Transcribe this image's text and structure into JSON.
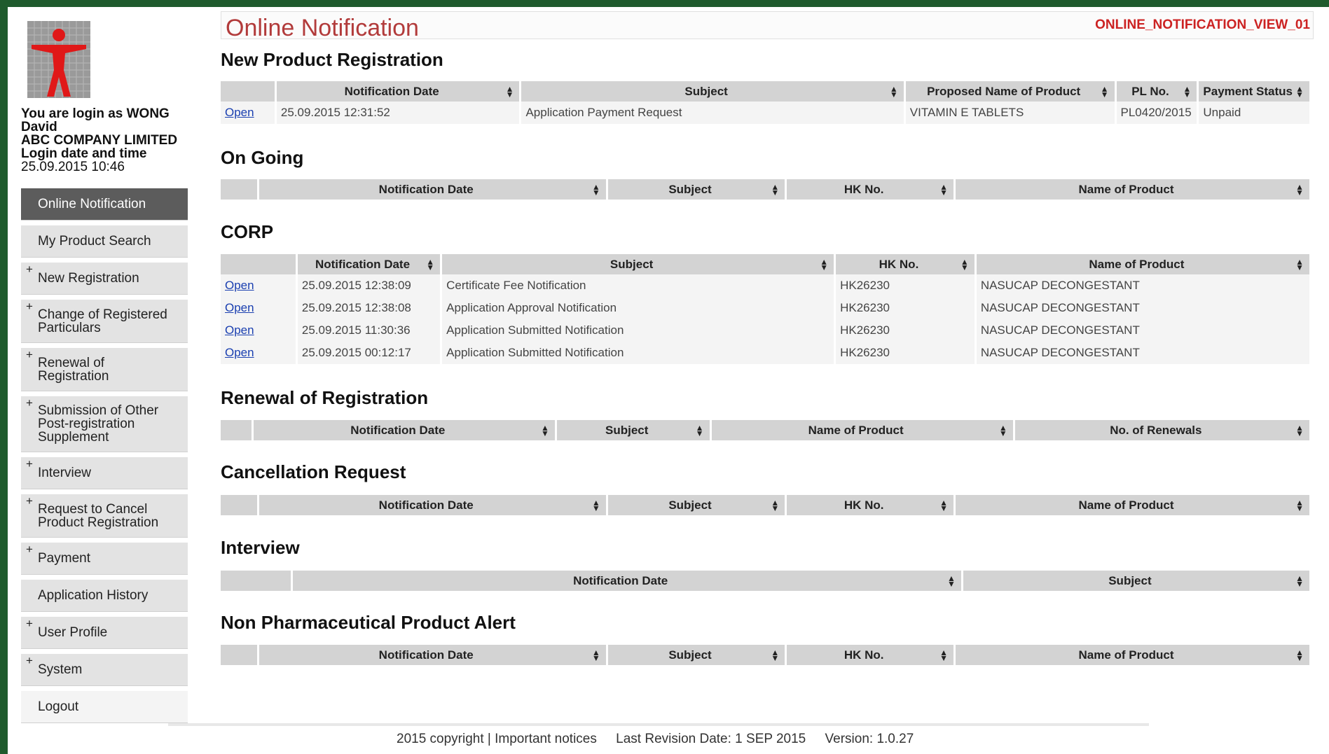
{
  "app": {
    "page_title": "Online Notification",
    "view_id": "ONLINE_NOTIFICATION_VIEW_01"
  },
  "login": {
    "line1": "You are login as WONG",
    "line2": "David",
    "company": "ABC COMPANY LIMITED",
    "label_datetime": "Login date and time",
    "datetime": "25.09.2015 10:46"
  },
  "menu": [
    {
      "label": "Online Notification",
      "plus": ""
    },
    {
      "label": "My Product Search",
      "plus": ""
    },
    {
      "label": "New Registration",
      "plus": "+"
    },
    {
      "label": "Change of Registered Particulars",
      "plus": "+"
    },
    {
      "label": "Renewal of Registration",
      "plus": "+"
    },
    {
      "label": "Submission of Other Post-registration Supplement",
      "plus": "+"
    },
    {
      "label": "Interview",
      "plus": "+"
    },
    {
      "label": "Request to Cancel Product Registration",
      "plus": "+"
    },
    {
      "label": "Payment",
      "plus": "+"
    },
    {
      "label": "Application History",
      "plus": ""
    },
    {
      "label": "User Profile",
      "plus": "+"
    },
    {
      "label": "System",
      "plus": "+"
    },
    {
      "label": "Logout",
      "plus": ""
    }
  ],
  "sections": {
    "new_product": {
      "title": "New Product Registration",
      "headers": [
        "",
        "Notification Date",
        "Subject",
        "Proposed Name of Product",
        "PL No.",
        "Payment Status"
      ],
      "rows": [
        [
          "Open",
          "25.09.2015 12:31:52",
          "Application Payment Request",
          "VITAMIN E TABLETS",
          "PL0420/2015",
          "Unpaid"
        ]
      ]
    },
    "on_going": {
      "title": "On Going",
      "headers": [
        "",
        "Notification Date",
        "Subject",
        "HK No.",
        "Name of Product"
      ]
    },
    "corp": {
      "title": "CORP",
      "headers": [
        "",
        "Notification Date",
        "Subject",
        "HK No.",
        "Name of Product"
      ],
      "rows": [
        [
          "Open",
          "25.09.2015 12:38:09",
          "Certificate Fee Notification",
          "HK26230",
          "NASUCAP DECONGESTANT"
        ],
        [
          "Open",
          "25.09.2015 12:38:08",
          "Application Approval Notification",
          "HK26230",
          "NASUCAP DECONGESTANT"
        ],
        [
          "Open",
          "25.09.2015 11:30:36",
          "Application Submitted Notification",
          "HK26230",
          "NASUCAP DECONGESTANT"
        ],
        [
          "Open",
          "25.09.2015 00:12:17",
          "Application Submitted Notification",
          "HK26230",
          "NASUCAP DECONGESTANT"
        ]
      ]
    },
    "renewal": {
      "title": "Renewal of Registration",
      "headers": [
        "",
        "Notification Date",
        "Subject",
        "Name of Product",
        "No. of Renewals"
      ]
    },
    "cancellation": {
      "title": "Cancellation Request",
      "headers": [
        "",
        "Notification Date",
        "Subject",
        "HK No.",
        "Name of Product"
      ]
    },
    "interview": {
      "title": "Interview",
      "headers": [
        "",
        "Notification Date",
        "Subject"
      ]
    },
    "non_pharma": {
      "title": "Non Pharmaceutical Product Alert",
      "headers": [
        "",
        "Notification Date",
        "Subject",
        "HK No.",
        "Name of Product"
      ]
    }
  },
  "footer": {
    "copyright": "2015 copyright | Important notices",
    "revision": "Last Revision Date: 1 SEP 2015",
    "version": "Version: 1.0.27"
  },
  "colors": {
    "frame": "#1f5b2d",
    "title_red": "#b23b3b",
    "view_id_red": "#cc2222",
    "link_blue": "#1a3fb0",
    "active_menu": "#5c5c5c"
  }
}
